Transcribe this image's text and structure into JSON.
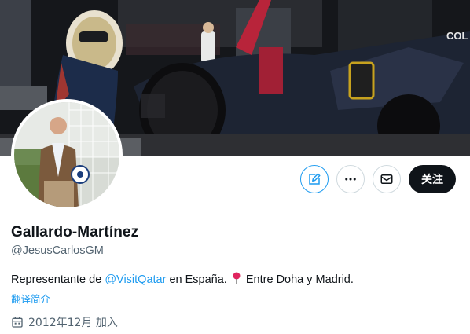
{
  "profile": {
    "display_name": "Gallardo-Martínez",
    "handle": "@JesusCarlosGM",
    "bio": {
      "before": "Representante de ",
      "mention": "@VisitQatar",
      "middle": " en España. ",
      "after": " Entre Doha y Madrid."
    },
    "translate_label": "翻译简介",
    "joined": "2012年12月 加入"
  },
  "actions": {
    "follow_label": "关注"
  },
  "banner": {
    "sponsor_text": "COL"
  },
  "colors": {
    "accent": "#1d9bf0",
    "text_primary": "#0f1419",
    "text_secondary": "#536471",
    "follow_bg": "#0f1419",
    "pin_red": "#e0245e"
  },
  "icons": [
    "edit-icon",
    "more-icon",
    "message-icon",
    "calendar-icon",
    "pin-icon"
  ]
}
